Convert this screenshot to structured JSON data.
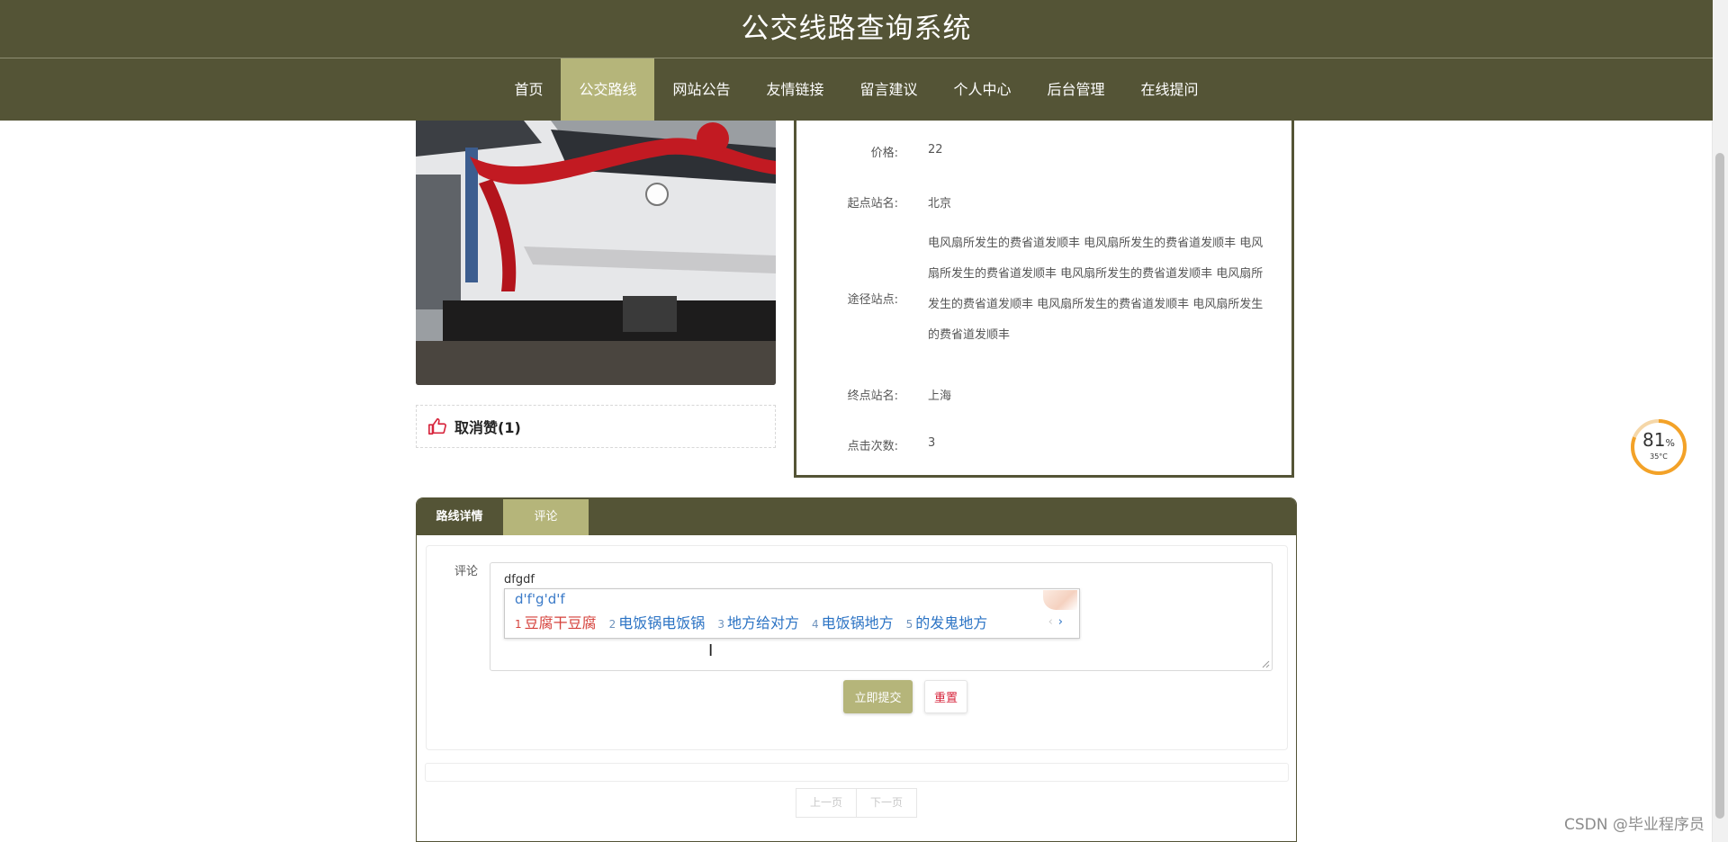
{
  "site": {
    "title": "公交线路查询系统"
  },
  "nav": {
    "items": [
      {
        "label": "首页"
      },
      {
        "label": "公交路线",
        "active": true
      },
      {
        "label": "网站公告"
      },
      {
        "label": "友情链接"
      },
      {
        "label": "留言建议"
      },
      {
        "label": "个人中心"
      },
      {
        "label": "后台管理"
      },
      {
        "label": "在线提问"
      }
    ]
  },
  "like": {
    "label": "取消赞(1)",
    "icon": "thumbs-up-icon"
  },
  "details": {
    "price_label": "价格:",
    "price": "22",
    "start_label": "起点站名:",
    "start": "北京",
    "via_label": "途径站点:",
    "via": "电风扇所发生的费省道发顺丰 电风扇所发生的费省道发顺丰 电风扇所发生的费省道发顺丰 电风扇所发生的费省道发顺丰 电风扇所发生的费省道发顺丰 电风扇所发生的费省道发顺丰 电风扇所发生的费省道发顺丰",
    "end_label": "终点站名:",
    "end": "上海",
    "clicks_label": "点击次数:",
    "clicks": "3"
  },
  "tabs": {
    "detail": "路线详情",
    "comment": "评论"
  },
  "comment": {
    "label": "评论",
    "value": "dfgdf",
    "submit": "立即提交",
    "reset": "重置"
  },
  "ime": {
    "input": "d'f'g'd'f",
    "candidates": [
      {
        "num": "1",
        "text": "豆腐干豆腐"
      },
      {
        "num": "2",
        "text": "电饭锅电饭锅"
      },
      {
        "num": "3",
        "text": "地方给对方"
      },
      {
        "num": "4",
        "text": "电饭锅地方"
      },
      {
        "num": "5",
        "text": "的发鬼地方"
      }
    ],
    "prev": "‹",
    "next": "›"
  },
  "pager": {
    "prev": "上一页",
    "next": "下一页"
  },
  "overlay": {
    "percent": "81",
    "percent_unit": "%",
    "temp": "35°C",
    "watermark": "CSDN @毕业程序员"
  },
  "colors": {
    "brand": "#545436",
    "accent": "#b5b57a",
    "reset": "#d7263d"
  }
}
